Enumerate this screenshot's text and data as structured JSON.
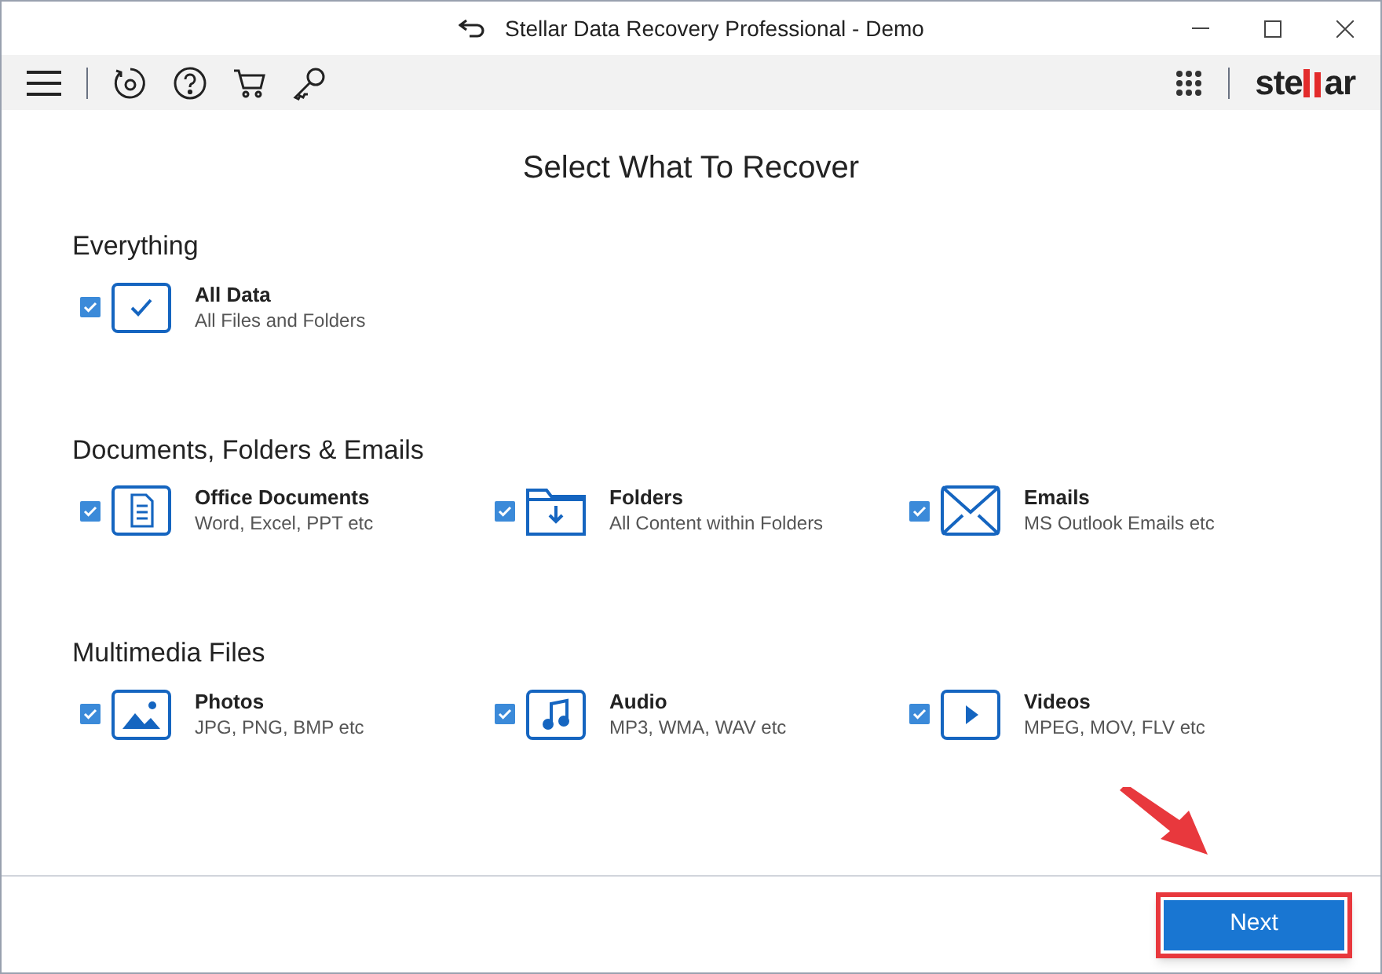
{
  "window": {
    "title": "Stellar Data Recovery Professional - Demo"
  },
  "logo": {
    "left": "ste",
    "right": "ar"
  },
  "heading": "Select What To Recover",
  "sections": [
    {
      "title": "Everything",
      "items": [
        {
          "kind": "all",
          "name": "All Data",
          "desc": "All Files and Folders",
          "checked": true
        }
      ]
    },
    {
      "title": "Documents, Folders & Emails",
      "items": [
        {
          "kind": "document",
          "name": "Office Documents",
          "desc": "Word, Excel, PPT etc",
          "checked": true
        },
        {
          "kind": "folder",
          "name": "Folders",
          "desc": "All Content within Folders",
          "checked": true
        },
        {
          "kind": "email",
          "name": "Emails",
          "desc": "MS Outlook Emails etc",
          "checked": true
        }
      ]
    },
    {
      "title": "Multimedia Files",
      "items": [
        {
          "kind": "photo",
          "name": "Photos",
          "desc": "JPG, PNG, BMP etc",
          "checked": true
        },
        {
          "kind": "audio",
          "name": "Audio",
          "desc": "MP3, WMA, WAV etc",
          "checked": true
        },
        {
          "kind": "video",
          "name": "Videos",
          "desc": "MPEG, MOV, FLV etc",
          "checked": true
        }
      ]
    }
  ],
  "next_button": "Next"
}
